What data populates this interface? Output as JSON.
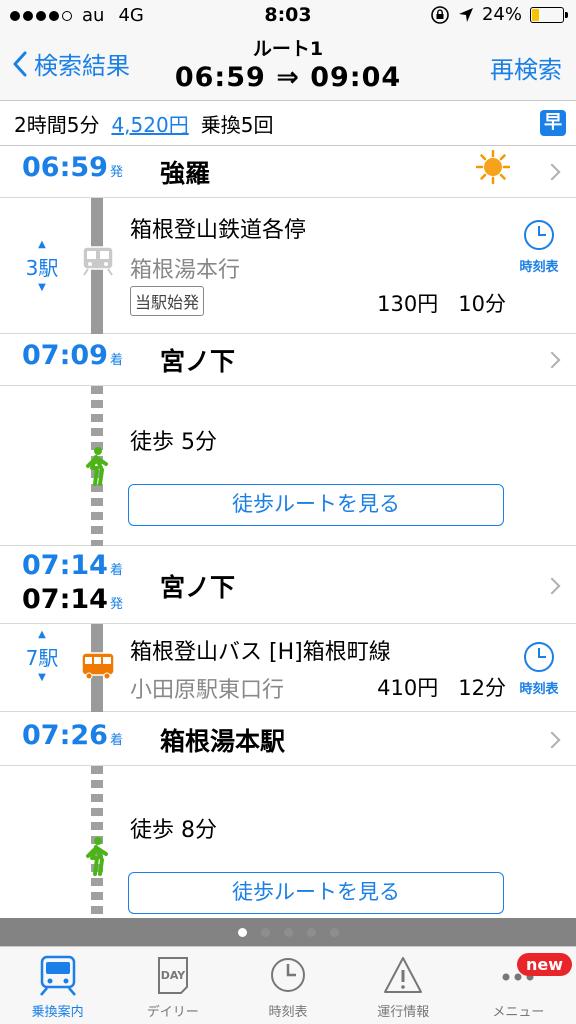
{
  "status_bar": {
    "carrier": "au",
    "network": "4G",
    "time": "8:03",
    "battery": "24%",
    "battery_level": 0.24,
    "signal_bars_filled": 4
  },
  "nav": {
    "back_label": "検索結果",
    "route_label": "ルート1",
    "times": "06:59 ⇒ 09:04",
    "research_label": "再検索"
  },
  "summary": {
    "duration": "2時間5分",
    "fare": "4,520円",
    "transfers": "乗換5回",
    "fast_badge": "早"
  },
  "itinerary": {
    "s1": {
      "time": "06:59",
      "suffix": "発",
      "name": "強羅",
      "weather_icon": "sun-icon"
    },
    "seg1": {
      "stops": "3駅",
      "line": "箱根登山鉄道各停",
      "dest": "箱根湯本行",
      "tag": "当駅始発",
      "fare": "130円",
      "duration": "10分",
      "timetable": "時刻表",
      "icon": "train-icon"
    },
    "s2": {
      "time": "07:09",
      "suffix": "着",
      "name": "宮ノ下"
    },
    "walk1": {
      "text": "徒歩 5分",
      "button": "徒歩ルートを見る"
    },
    "s3": {
      "arr_time": "07:14",
      "arr_suffix": "着",
      "dep_time": "07:14",
      "dep_suffix": "発",
      "name": "宮ノ下"
    },
    "seg2": {
      "stops": "7駅",
      "line": "箱根登山バス [H]箱根町線",
      "dest": "小田原駅東口行",
      "fare": "410円",
      "duration": "12分",
      "timetable": "時刻表",
      "icon": "bus-icon"
    },
    "s4": {
      "time": "07:26",
      "suffix": "着",
      "name": "箱根湯本駅"
    },
    "walk2": {
      "text": "徒歩 8分",
      "button": "徒歩ルートを見る"
    }
  },
  "pager": {
    "pages": 5,
    "active": 0
  },
  "tabs": [
    {
      "label": "乗換案内",
      "icon": "train-front-icon",
      "active": true
    },
    {
      "label": "デイリー",
      "icon": "calendar-day-icon",
      "day_text": "DAY"
    },
    {
      "label": "時刻表",
      "icon": "clock-icon"
    },
    {
      "label": "運行情報",
      "icon": "warning-icon"
    },
    {
      "label": "メニュー",
      "icon": "more-icon",
      "badge": "new"
    }
  ],
  "colors": {
    "accent": "#1a7fe6",
    "walk": "#4cb516",
    "bus": "#f07a00",
    "new_badge": "#e8252b"
  }
}
